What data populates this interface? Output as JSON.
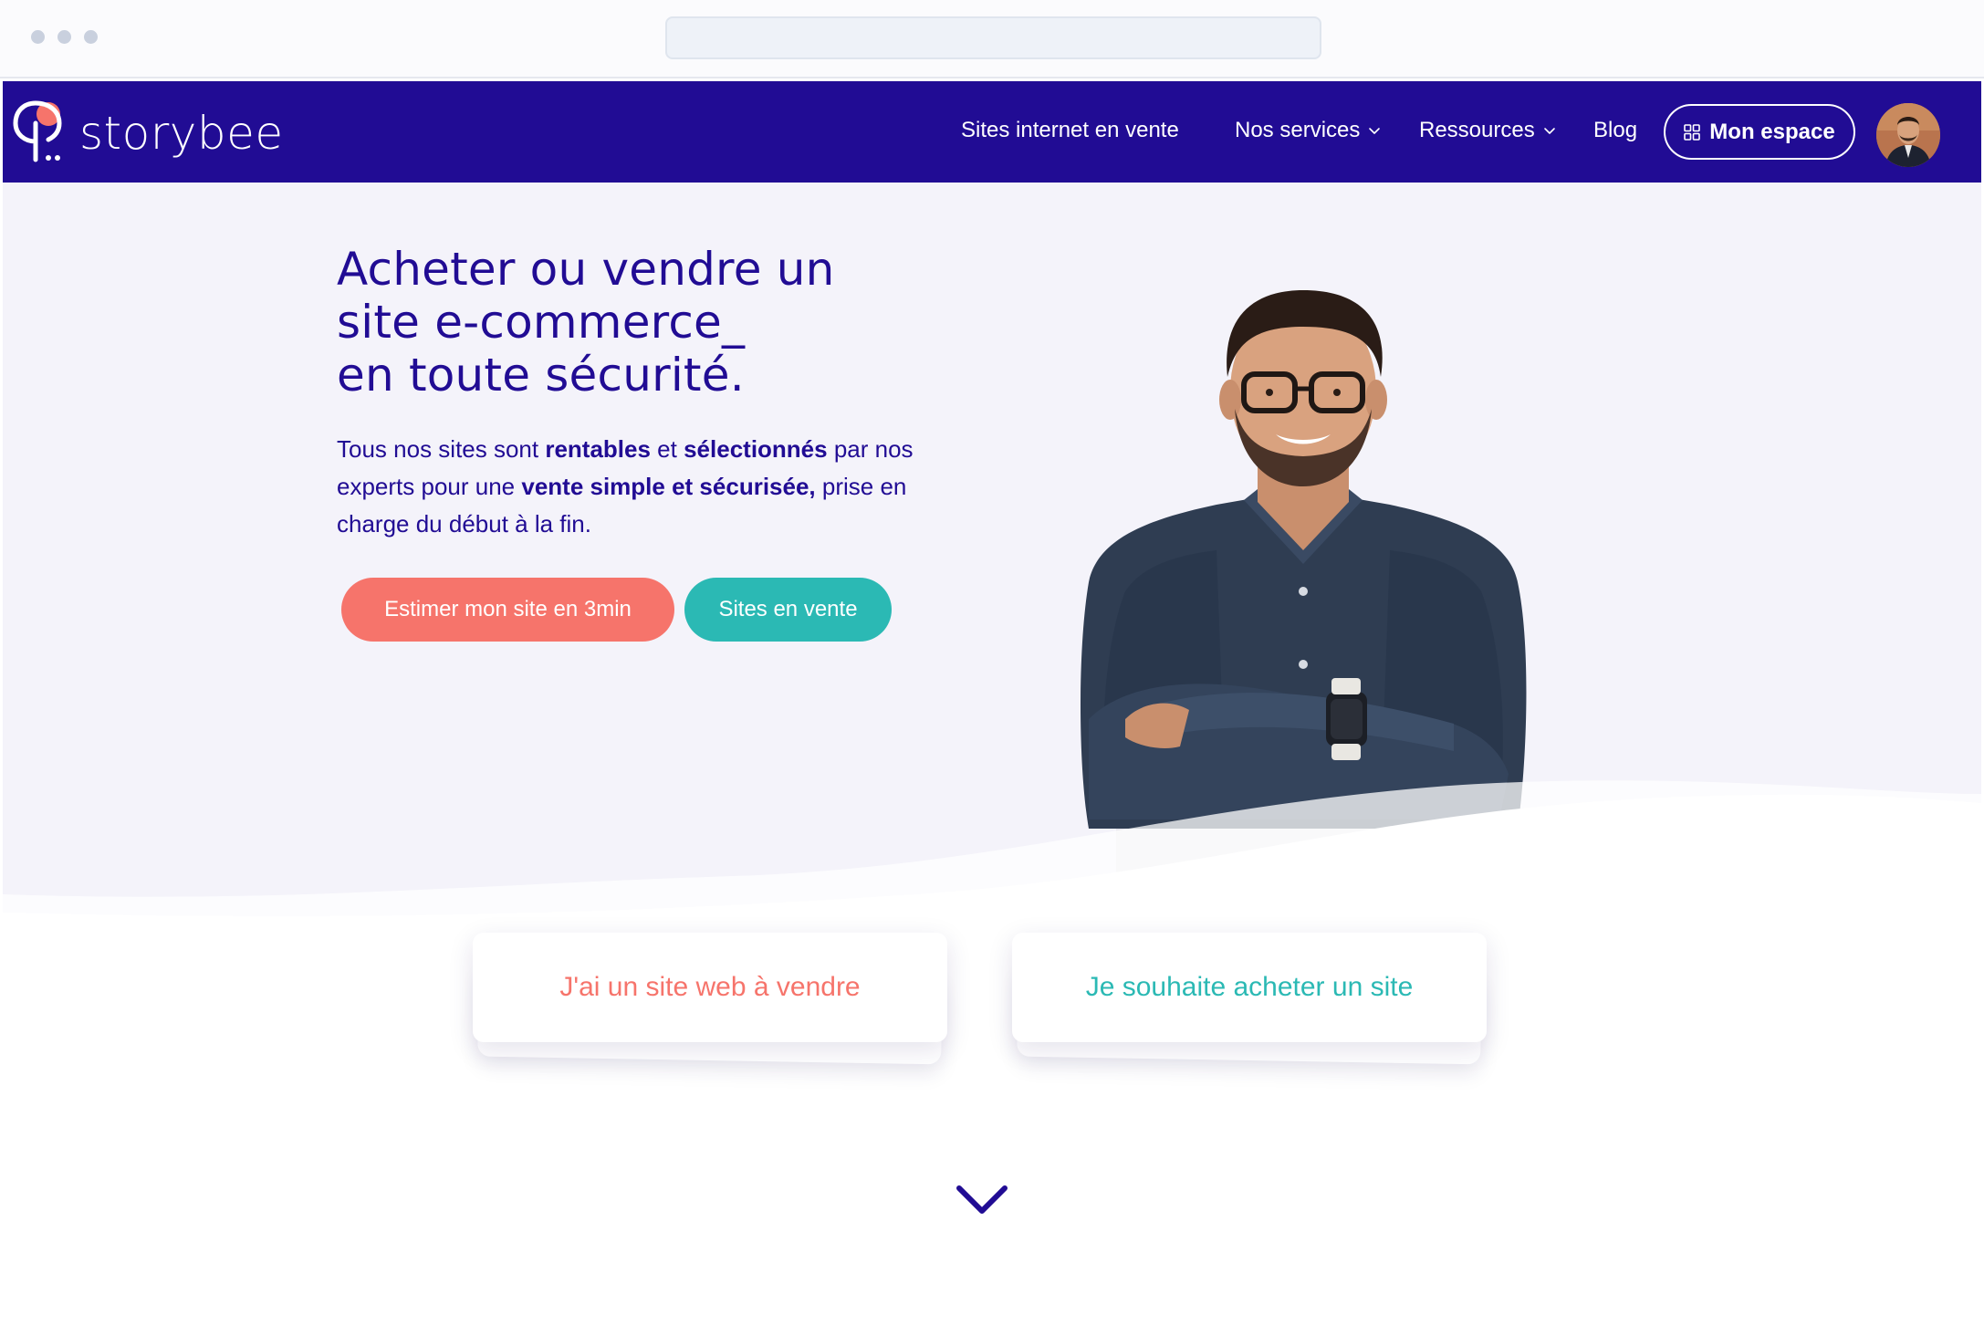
{
  "brand": {
    "name": "storybee",
    "navy": "#210c94",
    "coral": "#f6746b",
    "teal": "#2bb9b4",
    "hero_bg": "#f4f3fa"
  },
  "nav": {
    "links": [
      {
        "label": "Sites internet en vente",
        "dropdown": false
      },
      {
        "label": "Nos services",
        "dropdown": true,
        "icon": "chevron-down-icon"
      },
      {
        "label": "Ressources",
        "dropdown": true,
        "icon": "chevron-down-icon"
      },
      {
        "label": "Blog",
        "dropdown": false
      }
    ],
    "account_button": {
      "label": "Mon espace",
      "icon": "grid-icon"
    },
    "avatar_icon": "user-avatar"
  },
  "hero": {
    "title_lines": [
      "Acheter ou vendre un",
      "site e-commerce_",
      "en toute sécurité."
    ],
    "lead": {
      "p1": "Tous nos sites sont ",
      "b1": "rentables",
      "p2": " et ",
      "b2": "sélectionnés",
      "p3": " par nos experts pour une ",
      "b3": "vente simple et sécurisée,",
      "p4": " prise en charge du début à la fin."
    },
    "buttons": {
      "estimate": "Estimer mon site en 3min",
      "for_sale": "Sites en vente"
    }
  },
  "cards": {
    "sell": "J'ai un site web à vendre",
    "buy": "Je souhaite acheter un site"
  },
  "scroll_icon": "chevron-down-icon"
}
